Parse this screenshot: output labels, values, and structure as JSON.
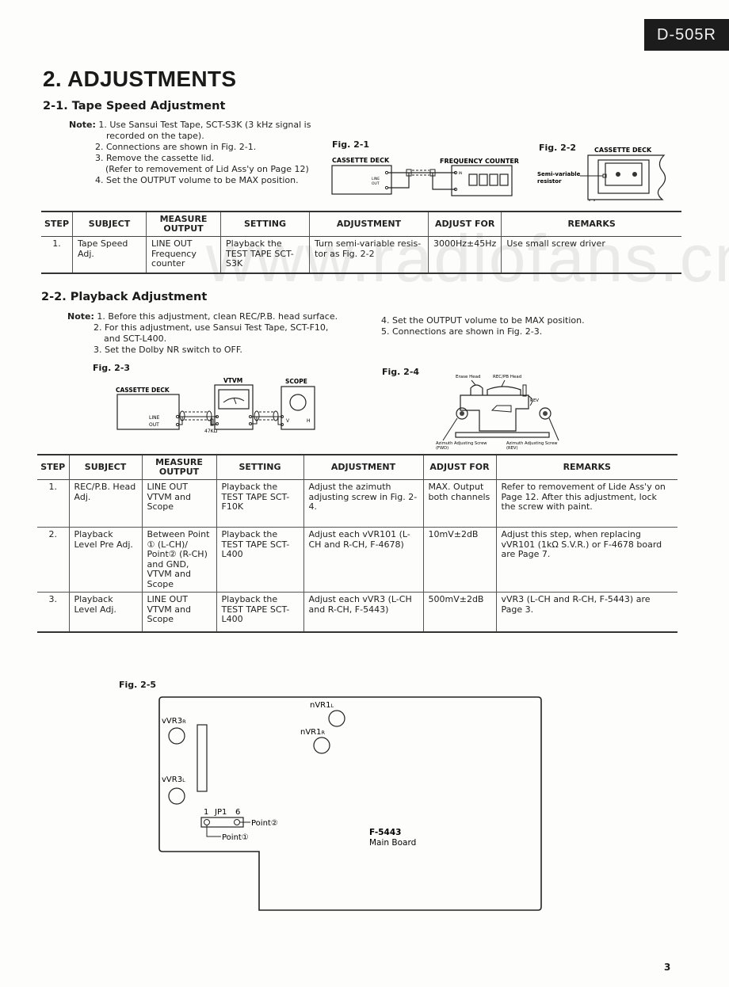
{
  "header": {
    "model": "D-505R"
  },
  "title": "2. ADJUSTMENTS",
  "watermark": "www.radiofans.cn",
  "section1": {
    "title": "2-1. Tape Speed Adjustment",
    "note_label": "Note:",
    "notes": [
      "1. Use Sansui Test Tape, SCT-S3K (3 kHz signal is",
      "recorded on the tape).",
      "2. Connections are shown in Fig. 2-1.",
      "3. Remove the cassette lid.",
      "(Refer to removement of Lid Ass'y on Page 12)",
      "4. Set the OUTPUT volume to be MAX position."
    ],
    "fig1": {
      "label": "Fig. 2-1",
      "deck": "CASSETTE DECK",
      "line_out_1": "LINE",
      "line_out_2": "OUT",
      "counter": "FREQUENCY COUNTER",
      "in": "IN"
    },
    "fig2": {
      "label": "Fig. 2-2",
      "deck": "CASSETTE DECK",
      "resistor_1": "Semi-variable",
      "resistor_2": "resistor"
    },
    "table": {
      "headers": [
        "STEP",
        "SUBJECT",
        "MEASURE OUTPUT",
        "SETTING",
        "ADJUSTMENT",
        "ADJUST FOR",
        "REMARKS"
      ],
      "rows": [
        [
          "1.",
          "Tape Speed Adj.",
          "LINE OUT Frequency counter",
          "Playback the TEST TAPE SCT-S3K",
          "Turn semi-variable resis-tor as Fig. 2-2",
          "3000Hz±45Hz",
          "Use small screw driver"
        ]
      ]
    }
  },
  "section2": {
    "title": "2-2. Playback Adjustment",
    "note_label": "Note:",
    "notes_left": [
      "1. Before this adjustment, clean REC/P.B. head surface.",
      "2. For this adjustment, use Sansui Test Tape, SCT-F10,",
      "and SCT-L400.",
      "3. Set the Dolby NR switch to OFF."
    ],
    "notes_right": [
      "4. Set the OUTPUT volume to be MAX position.",
      "5. Connections are shown in Fig. 2-3."
    ],
    "fig3": {
      "label": "Fig. 2-3",
      "deck": "CASSETTE DECK",
      "vtvm": "VTVM",
      "scope": "SCOPE",
      "line": "LINE",
      "out": "OUT",
      "resistor": "47KΩ",
      "v": "V",
      "h": "H"
    },
    "fig4": {
      "label": "Fig. 2-4",
      "erase_head": "Erase Head",
      "rec_head": "REC/PB Head",
      "rev": "REV",
      "screw_fwd_1": "Azimuth Adjusting Screw",
      "screw_fwd_2": "(FWD)",
      "screw_rev_1": "Azimuth Adjusting Screw",
      "screw_rev_2": "(REV)"
    },
    "table": {
      "headers": [
        "STEP",
        "SUBJECT",
        "MEASURE OUTPUT",
        "SETTING",
        "ADJUSTMENT",
        "ADJUST FOR",
        "REMARKS"
      ],
      "rows": [
        [
          "1.",
          "REC/P.B. Head Adj.",
          "LINE OUT VTVM and Scope",
          "Playback the TEST TAPE SCT-F10K",
          "Adjust the azimuth adjusting screw in Fig. 2-4.",
          "MAX. Output both channels",
          "Refer to removement of Lide Ass'y on Page 12. After this adjustment, lock the screw with paint."
        ],
        [
          "2.",
          "Playback Level Pre Adj.",
          "Between Point ① (L-CH)/ Point② (R-CH) and GND, VTVM and Scope",
          "Playback the TEST TAPE SCT-L400",
          "Adjust each vVR101 (L-CH and R-CH, F-4678)",
          "10mV±2dB",
          "Adjust this step, when replacing vVR101 (1kΩ S.V.R.) or F-4678 board are Page 7."
        ],
        [
          "3.",
          "Playback Level Adj.",
          "LINE OUT VTVM and Scope",
          "Playback the TEST TAPE SCT-L400",
          "Adjust each vVR3 (L-CH and R-CH, F-5443)",
          "500mV±2dB",
          "vVR3 (L-CH and R-CH, F-5443) are Page 3."
        ]
      ]
    }
  },
  "fig5": {
    "label": "Fig. 2-5",
    "vvr3r": "vVR3",
    "vvr3r_sub": "R",
    "vvr3l": "vVR3",
    "vvr3l_sub": "L",
    "nvr1l": "nVR1",
    "nvr1l_sub": "L",
    "nvr1r": "nVR1",
    "nvr1r_sub": "R",
    "jp1_pin1": "1",
    "jp1": "JP1",
    "jp1_pin6": "6",
    "point2": "Point②",
    "point1": "Point①",
    "board_id": "F-5443",
    "board_name": "Main Board"
  },
  "footer": {
    "page_number": "3"
  }
}
